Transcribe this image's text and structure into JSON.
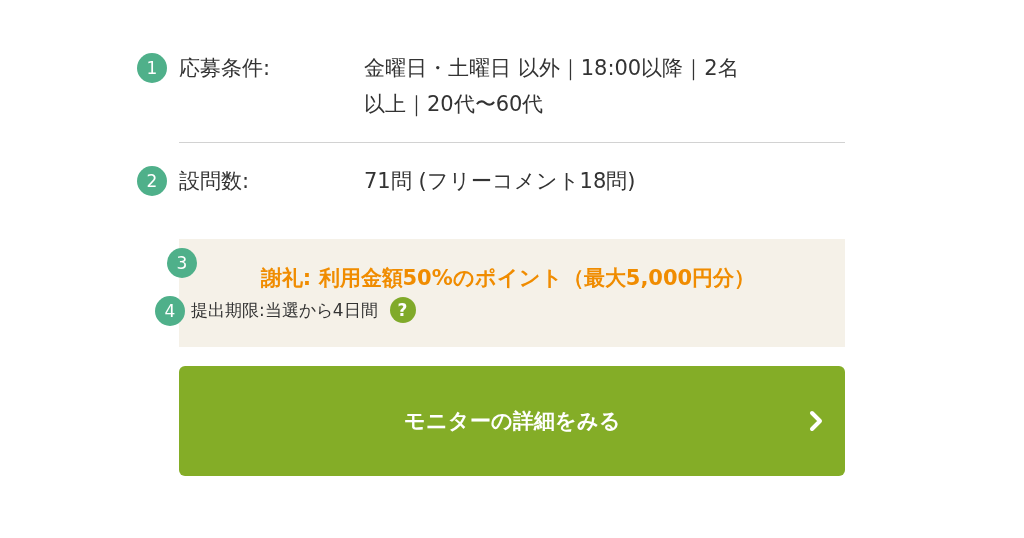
{
  "details": [
    {
      "marker": "1",
      "label": "応募条件:",
      "value": "金曜日・土曜日 以外｜18:00以降｜2名以上｜20代〜60代"
    },
    {
      "marker": "2",
      "label": "設問数:",
      "value": "71問 (フリーコメント18問)"
    }
  ],
  "reward": {
    "marker": "3",
    "text": "謝礼: 利用金額50%のポイント（最大5,000円分）"
  },
  "deadline": {
    "marker": "4",
    "text": "提出期限:当選から4日間",
    "help": "?"
  },
  "button": {
    "label": "モニターの詳細をみる"
  }
}
